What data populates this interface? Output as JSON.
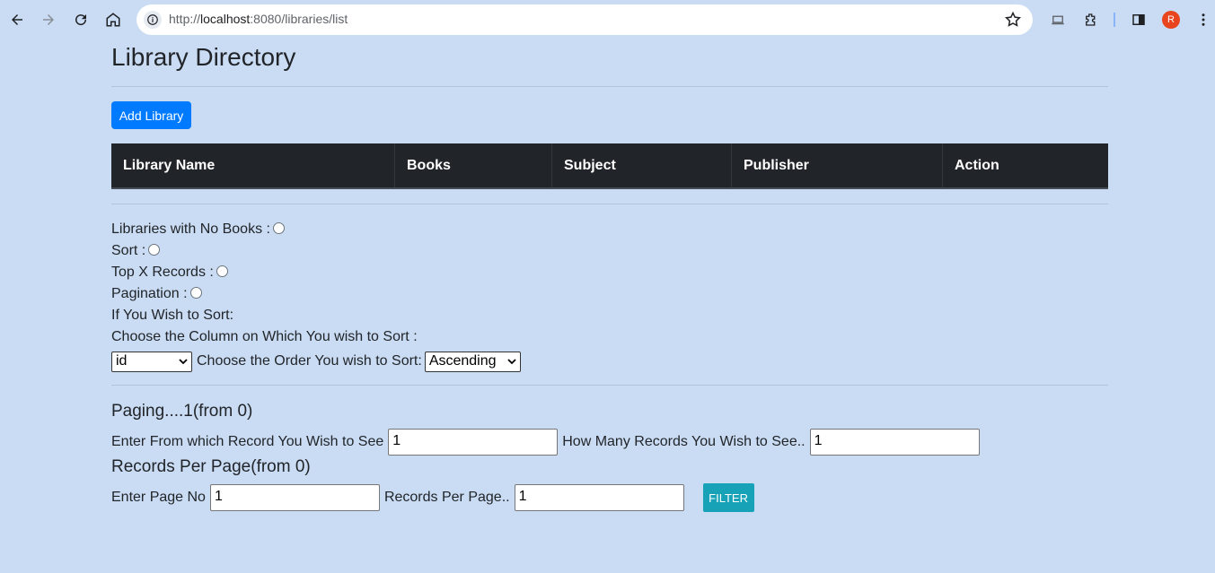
{
  "browser": {
    "url_prefix": "http://",
    "url_host": "localhost",
    "url_rest": ":8080/libraries/list",
    "profile_initial": "R"
  },
  "page": {
    "title": "Library Directory",
    "add_button": "Add Library",
    "table_headers": [
      "Library Name",
      "Books",
      "Subject",
      "Publisher",
      "Action"
    ],
    "options": {
      "no_books": "Libraries with No Books :",
      "sort": "Sort :",
      "top_x": "Top X Records :",
      "pagination": "Pagination :",
      "wish_sort": "If You Wish to Sort:",
      "choose_column": "Choose the Column on Which You wish to Sort :",
      "column_value": "id",
      "choose_order": "Choose the Order You wish to Sort:",
      "order_value": "Ascending"
    },
    "paging": {
      "heading": "Paging....1(from 0)",
      "from_label": "Enter From which Record You Wish to See",
      "from_value": "1",
      "how_many_label": "How Many Records You Wish to See..",
      "how_many_value": "1"
    },
    "per_page": {
      "heading": "Records Per Page(from 0)",
      "page_no_label": "Enter Page No",
      "page_no_value": "1",
      "records_label": "Records Per Page..",
      "records_value": "1",
      "filter_button": "FILTER"
    }
  },
  "colors": {
    "background": "#cadcf4",
    "primary": "#007bff",
    "info": "#17a2b8",
    "table_header": "#212529"
  }
}
